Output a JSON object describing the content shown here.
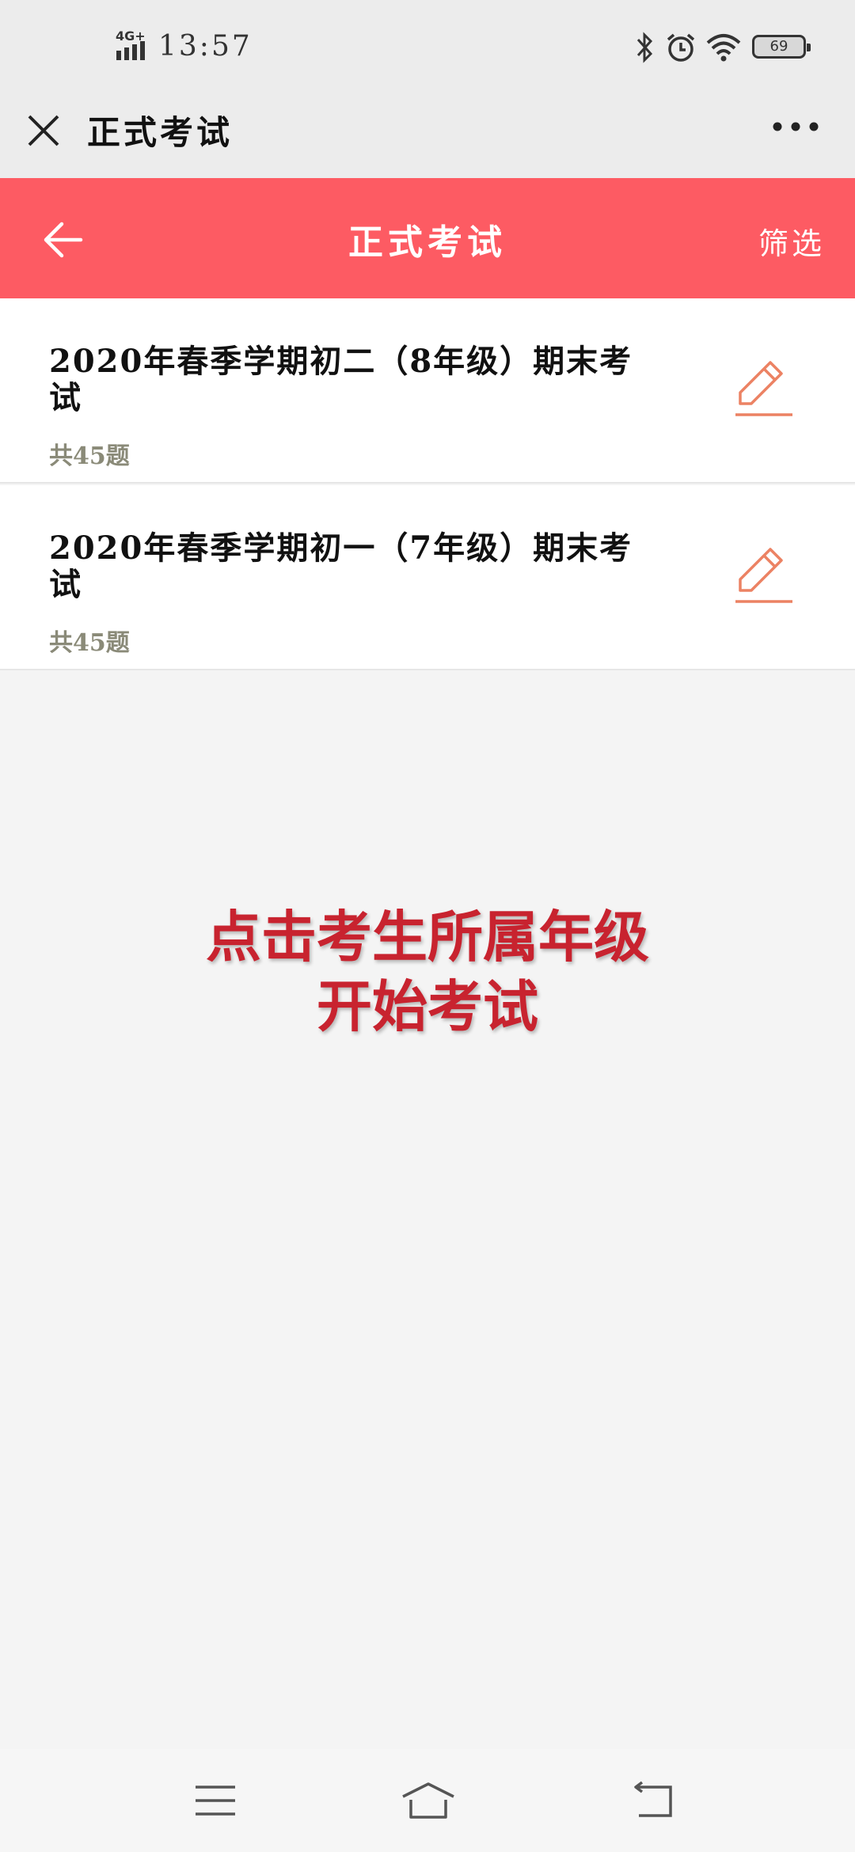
{
  "status_bar": {
    "network": "4G+",
    "time": "13:57",
    "battery": "69",
    "icons": [
      "bluetooth-icon",
      "alarm-icon",
      "wifi-icon",
      "battery-icon"
    ]
  },
  "title_bar": {
    "title": "正式考试",
    "close_icon": "close-icon",
    "more_icon": "more-icon"
  },
  "header": {
    "title": "正式考试",
    "filter_label": "筛选",
    "background": "#fd5b63"
  },
  "exams": [
    {
      "title": "2020年春季学期初二（8年级）期末考试",
      "count": "共45题"
    },
    {
      "title": "2020年春季学期初一（7年级）期末考试",
      "count": "共45题"
    }
  ],
  "overlay": {
    "line1": "点击考生所属年级",
    "line2": "开始考试",
    "color": "#c8232f"
  },
  "nav": {
    "icons": [
      "menu-icon",
      "home-icon",
      "back-icon"
    ]
  }
}
